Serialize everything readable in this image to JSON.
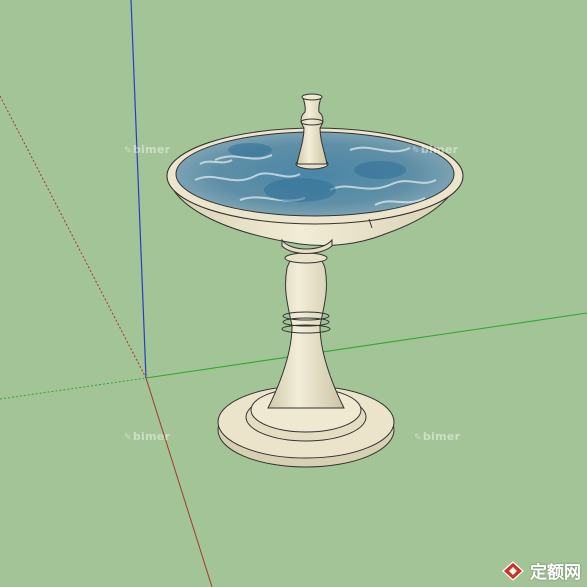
{
  "scene": {
    "background_color": "#a3c497",
    "axis_colors": {
      "blue": "#2a3cc4",
      "red": "#a23a2a",
      "green": "#2fa82f"
    },
    "object": {
      "stone_color": "#ece5cc",
      "water_color": "#5a8aa6"
    }
  },
  "watermarks": [
    {
      "mark": "✎",
      "text": "bimer"
    },
    {
      "mark": "✎",
      "text": "bimer"
    },
    {
      "mark": "✎",
      "text": "bimer"
    },
    {
      "mark": "✎",
      "text": "bimer"
    }
  ],
  "brand": {
    "logo_icon": "zhulong-logo-icon",
    "text": "定额网"
  }
}
